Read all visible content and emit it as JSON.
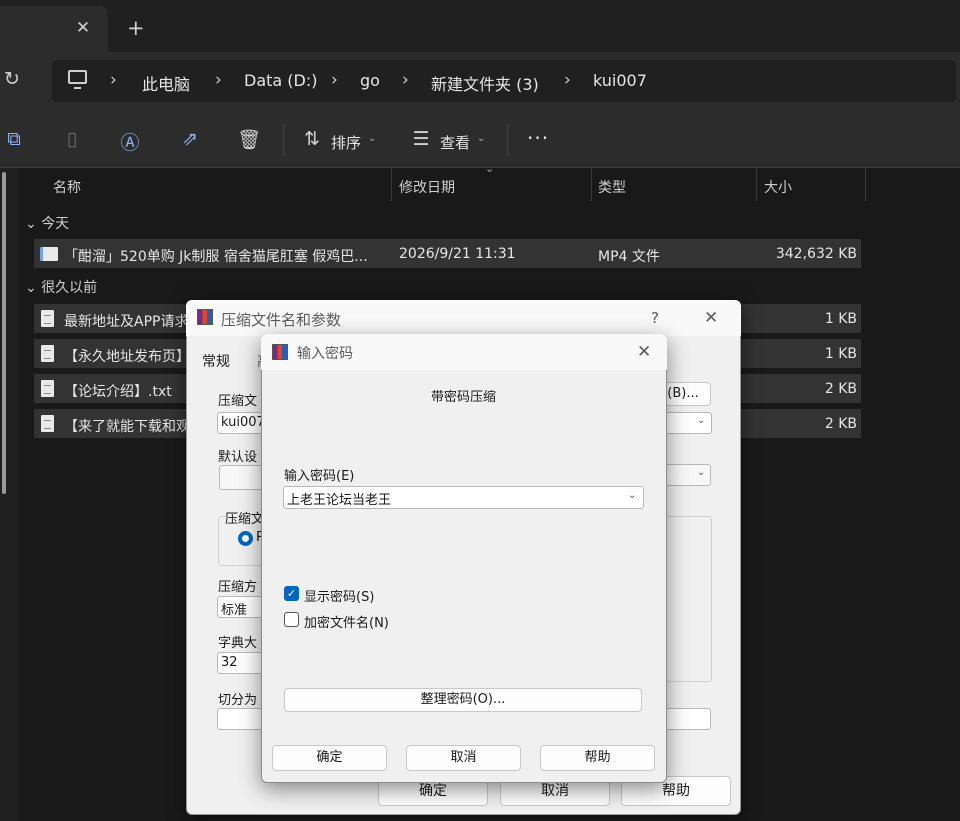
{
  "tab": {
    "close_glyph": "✕",
    "new_glyph": "+"
  },
  "address": {
    "refresh_glyph": "↻",
    "separator": "›",
    "crumbs": [
      "此电脑",
      "Data (D:)",
      "go",
      "新建文件夹 (3)",
      "kui007"
    ]
  },
  "toolbar": {
    "sort_label": "排序",
    "view_label": "查看",
    "more_glyph": "···",
    "icons": [
      "copy-icon",
      "paste-icon",
      "rename-icon",
      "share-icon",
      "delete-icon",
      "sort-icon",
      "view-icon"
    ]
  },
  "columns": {
    "name": "名称",
    "modified": "修改日期",
    "type": "类型",
    "size": "大小"
  },
  "groups": {
    "today": "今天",
    "long_ago": "很久以前"
  },
  "files": [
    {
      "name": "「酣溜」520单购 Jk制服 宿舍猫尾肛塞 假鸡巴...",
      "modified": "2026/9/21 11:31",
      "type": "MP4 文件",
      "size": "342,632 KB",
      "icon": "video-file-icon"
    },
    {
      "name": "最新地址及APP请求",
      "modified": "",
      "type": "",
      "size": "1 KB",
      "icon": "text-file-icon"
    },
    {
      "name": "【永久地址发布页】",
      "modified": "",
      "type": "",
      "size": "1 KB",
      "icon": "text-file-icon"
    },
    {
      "name": "【论坛介绍】.txt",
      "modified": "",
      "type": "",
      "size": "2 KB",
      "icon": "text-file-icon"
    },
    {
      "name": "【来了就能下载和观",
      "modified": "",
      "type": "",
      "size": "2 KB",
      "icon": "text-file-icon"
    }
  ],
  "archive_dialog": {
    "title": "压缩文件名和参数",
    "help_glyph": "?",
    "close_glyph": "✕",
    "tab_general": "常规",
    "tab_advanced": "高",
    "archive_name_label": "压缩文",
    "archive_name_value": "kui007",
    "browse_button": "(B)...",
    "default_profile_label": "默认设",
    "format_group_label": "压缩文",
    "format_radio": "R",
    "method_label": "压缩方",
    "method_value": "标准",
    "dict_label": "字典大",
    "dict_value": "32",
    "split_label": "切分为",
    "ok": "确定",
    "cancel": "取消",
    "help": "帮助"
  },
  "password_dialog": {
    "title": "输入密码",
    "close_glyph": "✕",
    "heading": "带密码压缩",
    "password_label": "输入密码(E)",
    "password_value": "上老王论坛当老王",
    "show_password": "显示密码(S)",
    "show_password_checked": true,
    "encrypt_filenames": "加密文件名(N)",
    "encrypt_filenames_checked": false,
    "organize_button": "整理密码(O)...",
    "ok": "确定",
    "cancel": "取消",
    "help": "帮助",
    "check_glyph": "✓"
  }
}
